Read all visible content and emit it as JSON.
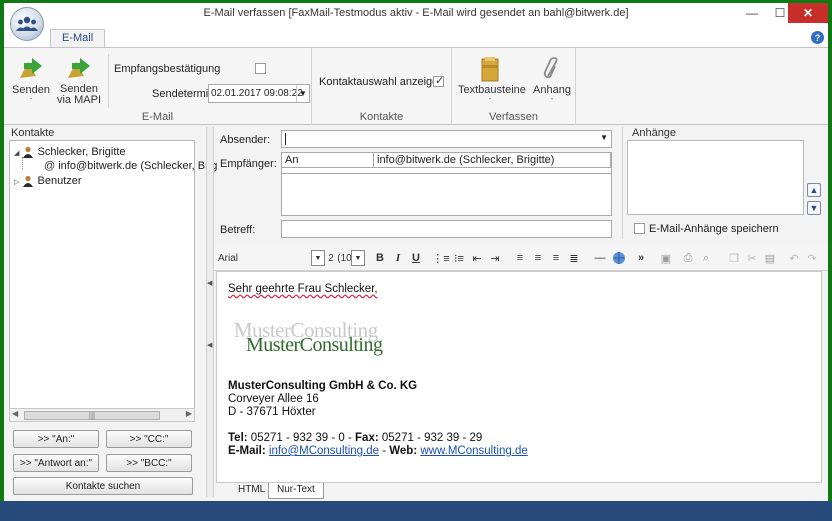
{
  "window": {
    "title": "E-Mail verfassen [FaxMail-Testmodus aktiv - E-Mail wird gesendet an bahl@bitwerk.de]",
    "minimize": "—",
    "maximize": "☐",
    "close": "✕",
    "help": "?"
  },
  "ribbon": {
    "tab": "E-Mail",
    "email_group": {
      "label": "E-Mail",
      "send": "Senden",
      "send_mapi_line1": "Senden",
      "send_mapi_line2": "via MAPI",
      "receipt_label": "Empfangsbestätigung",
      "send_date_label": "Sendetermin",
      "send_date_value": "02.01.2017 09:08:22"
    },
    "contacts_group": {
      "label": "Kontakte",
      "show_selection": "Kontaktauswahl anzeigen"
    },
    "compose_group": {
      "label": "Verfassen",
      "text_blocks": "Textbausteine",
      "attachment": "Anhang"
    }
  },
  "contacts": {
    "header": "Kontakte",
    "tree": [
      {
        "label": "Schlecker, Brigitte",
        "expander": "◢"
      },
      {
        "label": "info@bitwerk.de (Schlecker, Brig",
        "icon": "@"
      },
      {
        "label": "Benutzer",
        "expander": "▷"
      }
    ],
    "buttons": {
      "to": ">> \"An:\"",
      "cc": ">> \"CC:\"",
      "reply_to": ">> \"Antwort an:\"",
      "bcc": ">> \"BCC:\"",
      "search": "Kontakte suchen"
    }
  },
  "form": {
    "sender_label": "Absender:",
    "sender_value": "",
    "recipients_label": "Empfänger:",
    "recipients": [
      {
        "type": "An",
        "address": "info@bitwerk.de (Schlecker, Brigitte)"
      }
    ],
    "subject_label": "Betreff:",
    "subject_value": ""
  },
  "attachments": {
    "header": "Anhänge",
    "save_label": "E-Mail-Anhänge speichern"
  },
  "editor_toolbar": {
    "font": "Arial",
    "size": "2",
    "size_pt": "(10"
  },
  "editor": {
    "greeting": "Sehr geehrte Frau Schlecker,",
    "logo_text": "MusterConsulting",
    "company": "MusterConsulting GmbH & Co. KG",
    "street": "Corveyer Allee 16",
    "city": "D - 37671 Höxter",
    "tel_label": "Tel:",
    "tel_value": "05271 - 932 39 - 0",
    "fax_label": "Fax:",
    "fax_value": "05271 - 932 39 - 29",
    "email_label": "E-Mail:",
    "email_value": "info@MConsulting.de",
    "web_label": "Web:",
    "web_value": "www.MConsulting.de"
  },
  "bottom_tabs": [
    "HTML",
    "Nur-Text"
  ],
  "colors": {
    "frame": "#0f7a14",
    "statusbar": "#264b7b",
    "close": "#c7302a",
    "logo": "#2f6b2a",
    "link": "#1b4fb8"
  }
}
